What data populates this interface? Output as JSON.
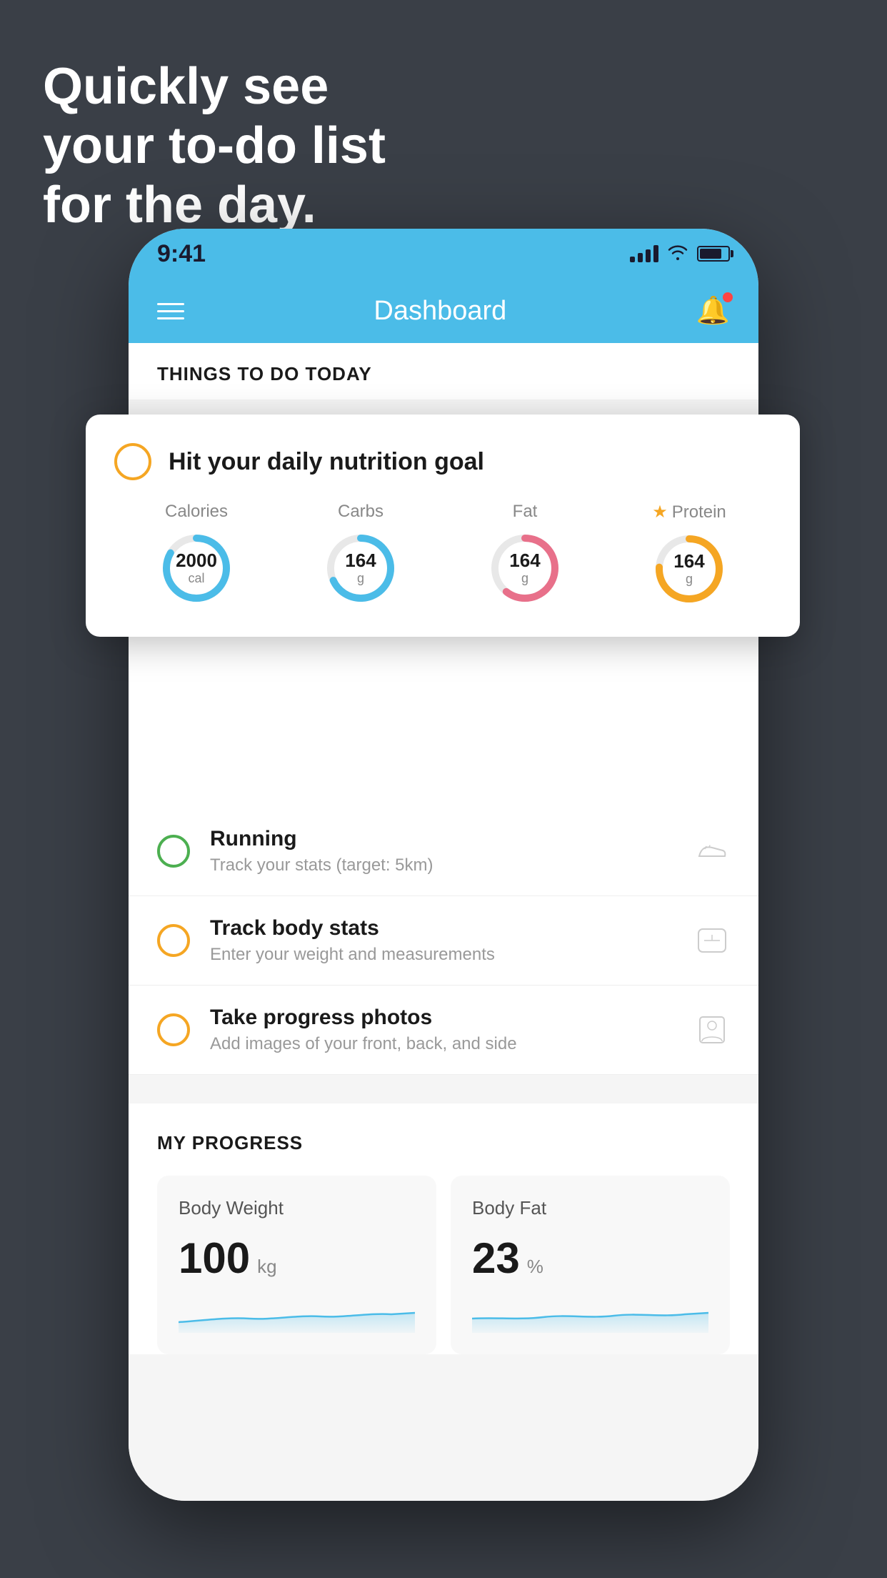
{
  "background": {
    "color": "#3a3f47"
  },
  "headline": {
    "line1": "Quickly see",
    "line2": "your to-do list",
    "line3": "for the day."
  },
  "statusBar": {
    "time": "9:41",
    "color": "#4bbce8"
  },
  "header": {
    "title": "Dashboard",
    "color": "#4bbce8"
  },
  "thingsToDo": {
    "sectionTitle": "THINGS TO DO TODAY",
    "featuredCard": {
      "title": "Hit your daily nutrition goal",
      "nutrients": [
        {
          "label": "Calories",
          "value": "2000",
          "unit": "cal",
          "color": "#4bbce8",
          "starred": false
        },
        {
          "label": "Carbs",
          "value": "164",
          "unit": "g",
          "color": "#4bbce8",
          "starred": false
        },
        {
          "label": "Fat",
          "value": "164",
          "unit": "g",
          "color": "#e8708a",
          "starred": false
        },
        {
          "label": "Protein",
          "value": "164",
          "unit": "g",
          "color": "#f5a623",
          "starred": true
        }
      ]
    },
    "listItems": [
      {
        "id": "running",
        "title": "Running",
        "subtitle": "Track your stats (target: 5km)",
        "checkColor": "green",
        "iconType": "shoe"
      },
      {
        "id": "body-stats",
        "title": "Track body stats",
        "subtitle": "Enter your weight and measurements",
        "checkColor": "yellow",
        "iconType": "scale"
      },
      {
        "id": "progress-photos",
        "title": "Take progress photos",
        "subtitle": "Add images of your front, back, and side",
        "checkColor": "yellow",
        "iconType": "person"
      }
    ]
  },
  "myProgress": {
    "sectionTitle": "MY PROGRESS",
    "cards": [
      {
        "id": "body-weight",
        "title": "Body Weight",
        "value": "100",
        "unit": "kg"
      },
      {
        "id": "body-fat",
        "title": "Body Fat",
        "value": "23",
        "unit": "%"
      }
    ]
  }
}
